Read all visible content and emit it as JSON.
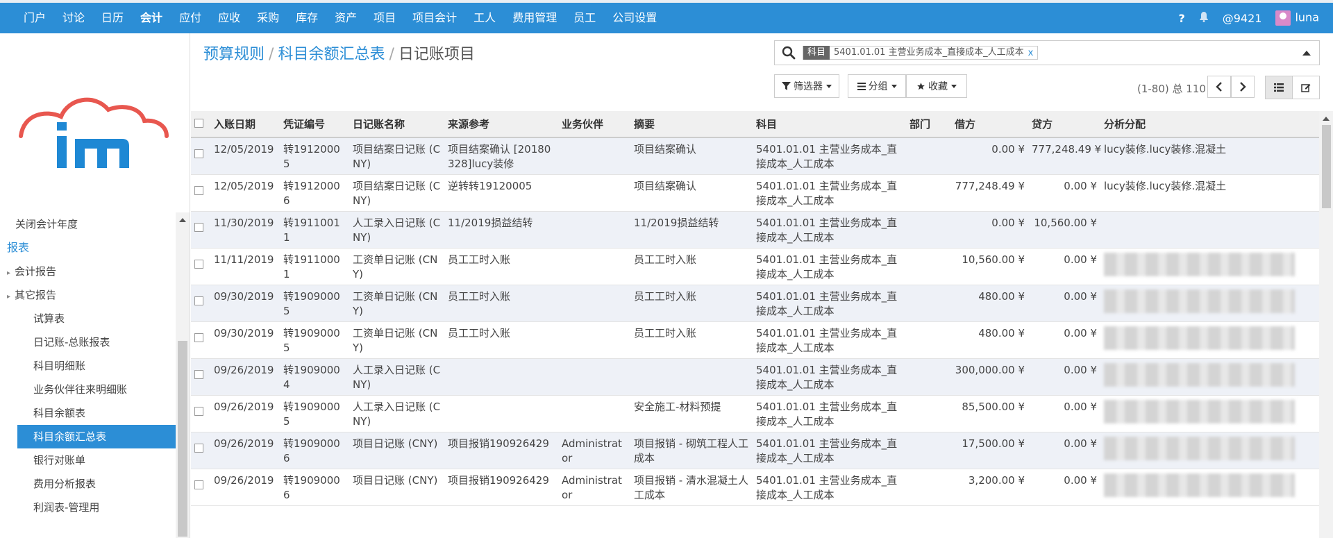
{
  "topnav": {
    "menu": [
      "门户",
      "讨论",
      "日历",
      "会计",
      "应付",
      "应收",
      "采购",
      "库存",
      "资产",
      "项目",
      "项目会计",
      "工人",
      "费用管理",
      "员工",
      "公司设置"
    ],
    "active": "会计",
    "help": "?",
    "messages": "9421",
    "user": "luna"
  },
  "sidebar": {
    "items": [
      {
        "label": "关闭会计年度",
        "kind": "group"
      },
      {
        "label": "报表",
        "kind": "section"
      },
      {
        "label": "会计报告",
        "kind": "group"
      },
      {
        "label": "其它报告",
        "kind": "group"
      },
      {
        "label": "试算表",
        "kind": "sub"
      },
      {
        "label": "日记账-总账报表",
        "kind": "sub"
      },
      {
        "label": "科目明细账",
        "kind": "sub"
      },
      {
        "label": "业务伙伴往来明细账",
        "kind": "sub"
      },
      {
        "label": "科目余额表",
        "kind": "sub"
      },
      {
        "label": "科目余额汇总表",
        "kind": "sub-active"
      },
      {
        "label": "银行对账单",
        "kind": "sub"
      },
      {
        "label": "费用分析报表",
        "kind": "sub"
      },
      {
        "label": "利润表-管理用",
        "kind": "sub"
      }
    ]
  },
  "breadcrumb": {
    "items": [
      "预算规则",
      "科目余额汇总表"
    ],
    "current": "日记账项目"
  },
  "search": {
    "facet_label": "科目",
    "facet_value": "5401.01.01 主营业务成本_直接成本_人工成本",
    "remove": "x"
  },
  "toolbar": {
    "filters": "筛选器",
    "groupby": "分组",
    "favorites": "收藏",
    "pager": "(1-80) 总 110"
  },
  "table": {
    "columns": [
      "入账日期",
      "凭证编号",
      "日记账名称",
      "来源参考",
      "业务伙伴",
      "摘要",
      "科目",
      "部门",
      "借方",
      "贷方",
      "分析分配"
    ],
    "rows": [
      {
        "date": "12/05/2019",
        "voucher": "转19120005",
        "journal": "项目结案日记账 (CNY)",
        "ref": "项目结案确认 [20180328]lucy装修",
        "partner": "",
        "memo": "项目结案确认",
        "account": "5401.01.01 主营业务成本_直接成本_人工成本",
        "dept": "",
        "debit": "0.00 ¥",
        "credit": "777,248.49 ¥",
        "analytic": "lucy装修.lucy装修.混凝土",
        "blur": false
      },
      {
        "date": "12/05/2019",
        "voucher": "转19120006",
        "journal": "项目结案日记账 (CNY)",
        "ref": "逆转转19120005",
        "partner": "",
        "memo": "项目结案确认",
        "account": "5401.01.01 主营业务成本_直接成本_人工成本",
        "dept": "",
        "debit": "777,248.49 ¥",
        "credit": "0.00 ¥",
        "analytic": "lucy装修.lucy装修.混凝土",
        "blur": false
      },
      {
        "date": "11/30/2019",
        "voucher": "转19110011",
        "journal": "人工录入日记账 (CNY)",
        "ref": "11/2019损益结转",
        "partner": "",
        "memo": "11/2019损益结转",
        "account": "5401.01.01 主营业务成本_直接成本_人工成本",
        "dept": "",
        "debit": "0.00 ¥",
        "credit": "10,560.00 ¥",
        "analytic": "",
        "blur": false
      },
      {
        "date": "11/11/2019",
        "voucher": "转19110001",
        "journal": "工资单日记账 (CNY)",
        "ref": "员工工时入账",
        "partner": "",
        "memo": "员工工时入账",
        "account": "5401.01.01 主营业务成本_直接成本_人工成本",
        "dept": "",
        "debit": "10,560.00 ¥",
        "credit": "0.00 ¥",
        "analytic": "",
        "blur": true
      },
      {
        "date": "09/30/2019",
        "voucher": "转19090005",
        "journal": "工资单日记账 (CNY)",
        "ref": "员工工时入账",
        "partner": "",
        "memo": "员工工时入账",
        "account": "5401.01.01 主营业务成本_直接成本_人工成本",
        "dept": "",
        "debit": "480.00 ¥",
        "credit": "0.00 ¥",
        "analytic": "",
        "blur": true
      },
      {
        "date": "09/30/2019",
        "voucher": "转19090005",
        "journal": "工资单日记账 (CNY)",
        "ref": "员工工时入账",
        "partner": "",
        "memo": "员工工时入账",
        "account": "5401.01.01 主营业务成本_直接成本_人工成本",
        "dept": "",
        "debit": "480.00 ¥",
        "credit": "0.00 ¥",
        "analytic": "",
        "blur": true
      },
      {
        "date": "09/26/2019",
        "voucher": "转19090004",
        "journal": "人工录入日记账 (CNY)",
        "ref": "",
        "partner": "",
        "memo": "",
        "account": "5401.01.01 主营业务成本_直接成本_人工成本",
        "dept": "",
        "debit": "300,000.00 ¥",
        "credit": "0.00 ¥",
        "analytic": "",
        "blur": true
      },
      {
        "date": "09/26/2019",
        "voucher": "转19090005",
        "journal": "人工录入日记账 (CNY)",
        "ref": "",
        "partner": "",
        "memo": "安全施工-材料预提",
        "account": "5401.01.01 主营业务成本_直接成本_人工成本",
        "dept": "",
        "debit": "85,500.00 ¥",
        "credit": "0.00 ¥",
        "analytic": "",
        "blur": true
      },
      {
        "date": "09/26/2019",
        "voucher": "转19090006",
        "journal": "项目日记账 (CNY)",
        "ref": "项目报销190926429",
        "partner": "Administrator",
        "memo": "项目报销 - 砌筑工程人工成本",
        "account": "5401.01.01 主营业务成本_直接成本_人工成本",
        "dept": "",
        "debit": "17,500.00 ¥",
        "credit": "0.00 ¥",
        "analytic": "",
        "blur": true
      },
      {
        "date": "09/26/2019",
        "voucher": "转19090006",
        "journal": "项目日记账 (CNY)",
        "ref": "项目报销190926429",
        "partner": "Administrator",
        "memo": "项目报销 - 清水混凝土人工成本",
        "account": "5401.01.01 主营业务成本_直接成本_人工成本",
        "dept": "",
        "debit": "3,200.00 ¥",
        "credit": "0.00 ¥",
        "analytic": "",
        "blur": true
      }
    ]
  },
  "colors": {
    "brand": "#2c8ed6",
    "logo_red": "#e8574f",
    "logo_blue": "#1e88d4"
  }
}
